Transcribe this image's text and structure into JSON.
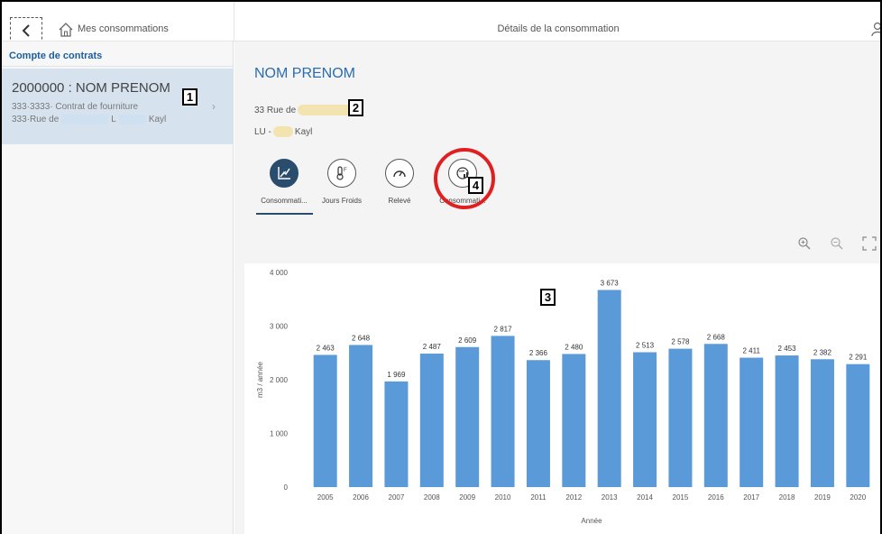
{
  "nav": {
    "title": "Mes consommations",
    "detail_title": "Détails de la consommation"
  },
  "sidebar": {
    "header": "Compte de contrats",
    "contract": {
      "title": "2000000 : NOM PRENOM",
      "subtitle": "333·3333· Contrat de fourniture",
      "address_prefix": "333·Rue de",
      "address_mid": "L",
      "address_city": "Kayl"
    }
  },
  "detail": {
    "name": "NOM PRENOM",
    "address_line1": "33 Rue de",
    "address_line2_prefix": "LU -",
    "address_line2_city": "Kayl"
  },
  "tabs": [
    {
      "label": "Consommati...",
      "icon": "chart-icon",
      "active": true
    },
    {
      "label": "Jours Froids",
      "icon": "thermometer-icon",
      "active": false
    },
    {
      "label": "Relevé",
      "icon": "gauge-icon",
      "active": false
    },
    {
      "label": "Consommati...",
      "icon": "globe-chart-icon",
      "active": false
    }
  ],
  "markers": [
    "1",
    "2",
    "3",
    "4"
  ],
  "toolbar": {
    "zoom_in": "zoom-in-icon",
    "zoom_out": "zoom-out-icon",
    "fullscreen": "fullscreen-icon"
  },
  "colors": {
    "bar": "#5b9ad8",
    "accent": "#2b6cb0",
    "highlight": "#e02020"
  },
  "chart_data": {
    "type": "bar",
    "categories": [
      "2005",
      "2006",
      "2007",
      "2008",
      "2009",
      "2010",
      "2011",
      "2012",
      "2013",
      "2014",
      "2015",
      "2016",
      "2017",
      "2018",
      "2019",
      "2020"
    ],
    "values": [
      2463,
      2648,
      1969,
      2487,
      2609,
      2817,
      2366,
      2480,
      3673,
      2513,
      2578,
      2668,
      2411,
      2453,
      2382,
      2291
    ],
    "value_labels": [
      "2 463",
      "2 648",
      "1 969",
      "2 487",
      "2 609",
      "2 817",
      "2 366",
      "2 480",
      "3 673",
      "2 513",
      "2 578",
      "2 668",
      "2 411",
      "2 453",
      "2 382",
      "2 291"
    ],
    "yticks": [
      "0",
      "1 000",
      "2 000",
      "3 000",
      "4 000"
    ],
    "ytick_values": [
      0,
      1000,
      2000,
      3000,
      4000
    ],
    "ylim": [
      0,
      4000
    ],
    "xlabel": "Année",
    "ylabel": "m3 / année",
    "grid": false
  }
}
